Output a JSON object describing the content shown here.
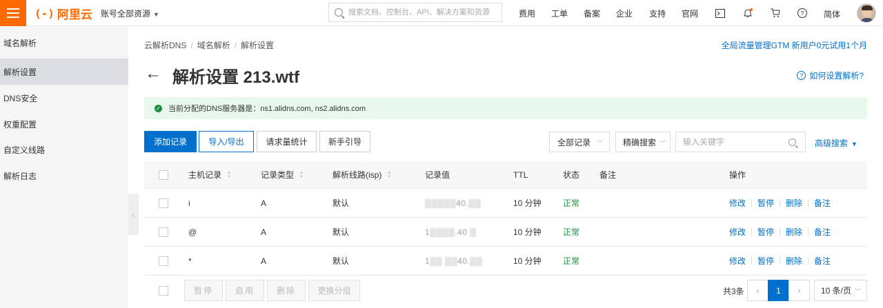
{
  "topbar": {
    "logo_text": "阿里云",
    "logo_mark": "(-)",
    "account_label": "账号全部资源",
    "search_placeholder": "搜索文档、控制台、API、解决方案和资源",
    "nav": [
      "费用",
      "工单",
      "备案",
      "企业",
      "支持",
      "官网"
    ],
    "lang": "简体"
  },
  "sidebar": {
    "items": [
      {
        "label": "域名解析",
        "active": false
      },
      {
        "label": "解析设置",
        "active": true
      },
      {
        "label": "DNS安全",
        "active": false
      },
      {
        "label": "权重配置",
        "active": false
      },
      {
        "label": "自定义线路",
        "active": false
      },
      {
        "label": "解析日志",
        "active": false
      }
    ]
  },
  "breadcrumb": [
    "云解析DNS",
    "域名解析",
    "解析设置"
  ],
  "promo_link": "全局流量管理GTM 新用户0元试用1个月",
  "page_title": "解析设置 213.wtf",
  "howto_link": "如何设置解析?",
  "notice": "当前分配的DNS服务器是：ns1.alidns.com, ns2.alidns.com",
  "toolbar": {
    "add": "添加记录",
    "import_export": "导入/导出",
    "stats": "请求量统计",
    "guide": "新手引导",
    "filter_all": "全部记录",
    "exact_search": "精确搜索",
    "keyword_placeholder": "输入关键字",
    "advanced": "高级搜索"
  },
  "table": {
    "headers": {
      "host": "主机记录",
      "type": "记录类型",
      "line": "解析线路(isp)",
      "value": "记录值",
      "ttl": "TTL",
      "status": "状态",
      "remark": "备注",
      "ops": "操作"
    },
    "rows": [
      {
        "host": "i",
        "type": "A",
        "line": "默认",
        "value": "▒▒▒▒▒40.▒▒",
        "ttl": "10 分钟",
        "status": "正常"
      },
      {
        "host": "@",
        "type": "A",
        "line": "默认",
        "value": "1▒▒▒▒.40 ▒",
        "ttl": "10 分钟",
        "status": "正常"
      },
      {
        "host": "*",
        "type": "A",
        "line": "默认",
        "value": "1▒▒ ▒▒40.▒▒",
        "ttl": "10 分钟",
        "status": "正常"
      }
    ],
    "op_labels": {
      "edit": "修改",
      "pause": "暂停",
      "delete": "删除",
      "remark": "备注"
    }
  },
  "footer": {
    "pause": "暂停",
    "enable": "启用",
    "delete": "删除",
    "change_group": "更换分组",
    "total": "共3条",
    "current_page": "1",
    "per_page": "10 条/页"
  },
  "colors": {
    "brand": "#ff6a00",
    "primary": "#0070cc",
    "success": "#1e8e3e",
    "notice_bg": "#e9f8ed"
  }
}
